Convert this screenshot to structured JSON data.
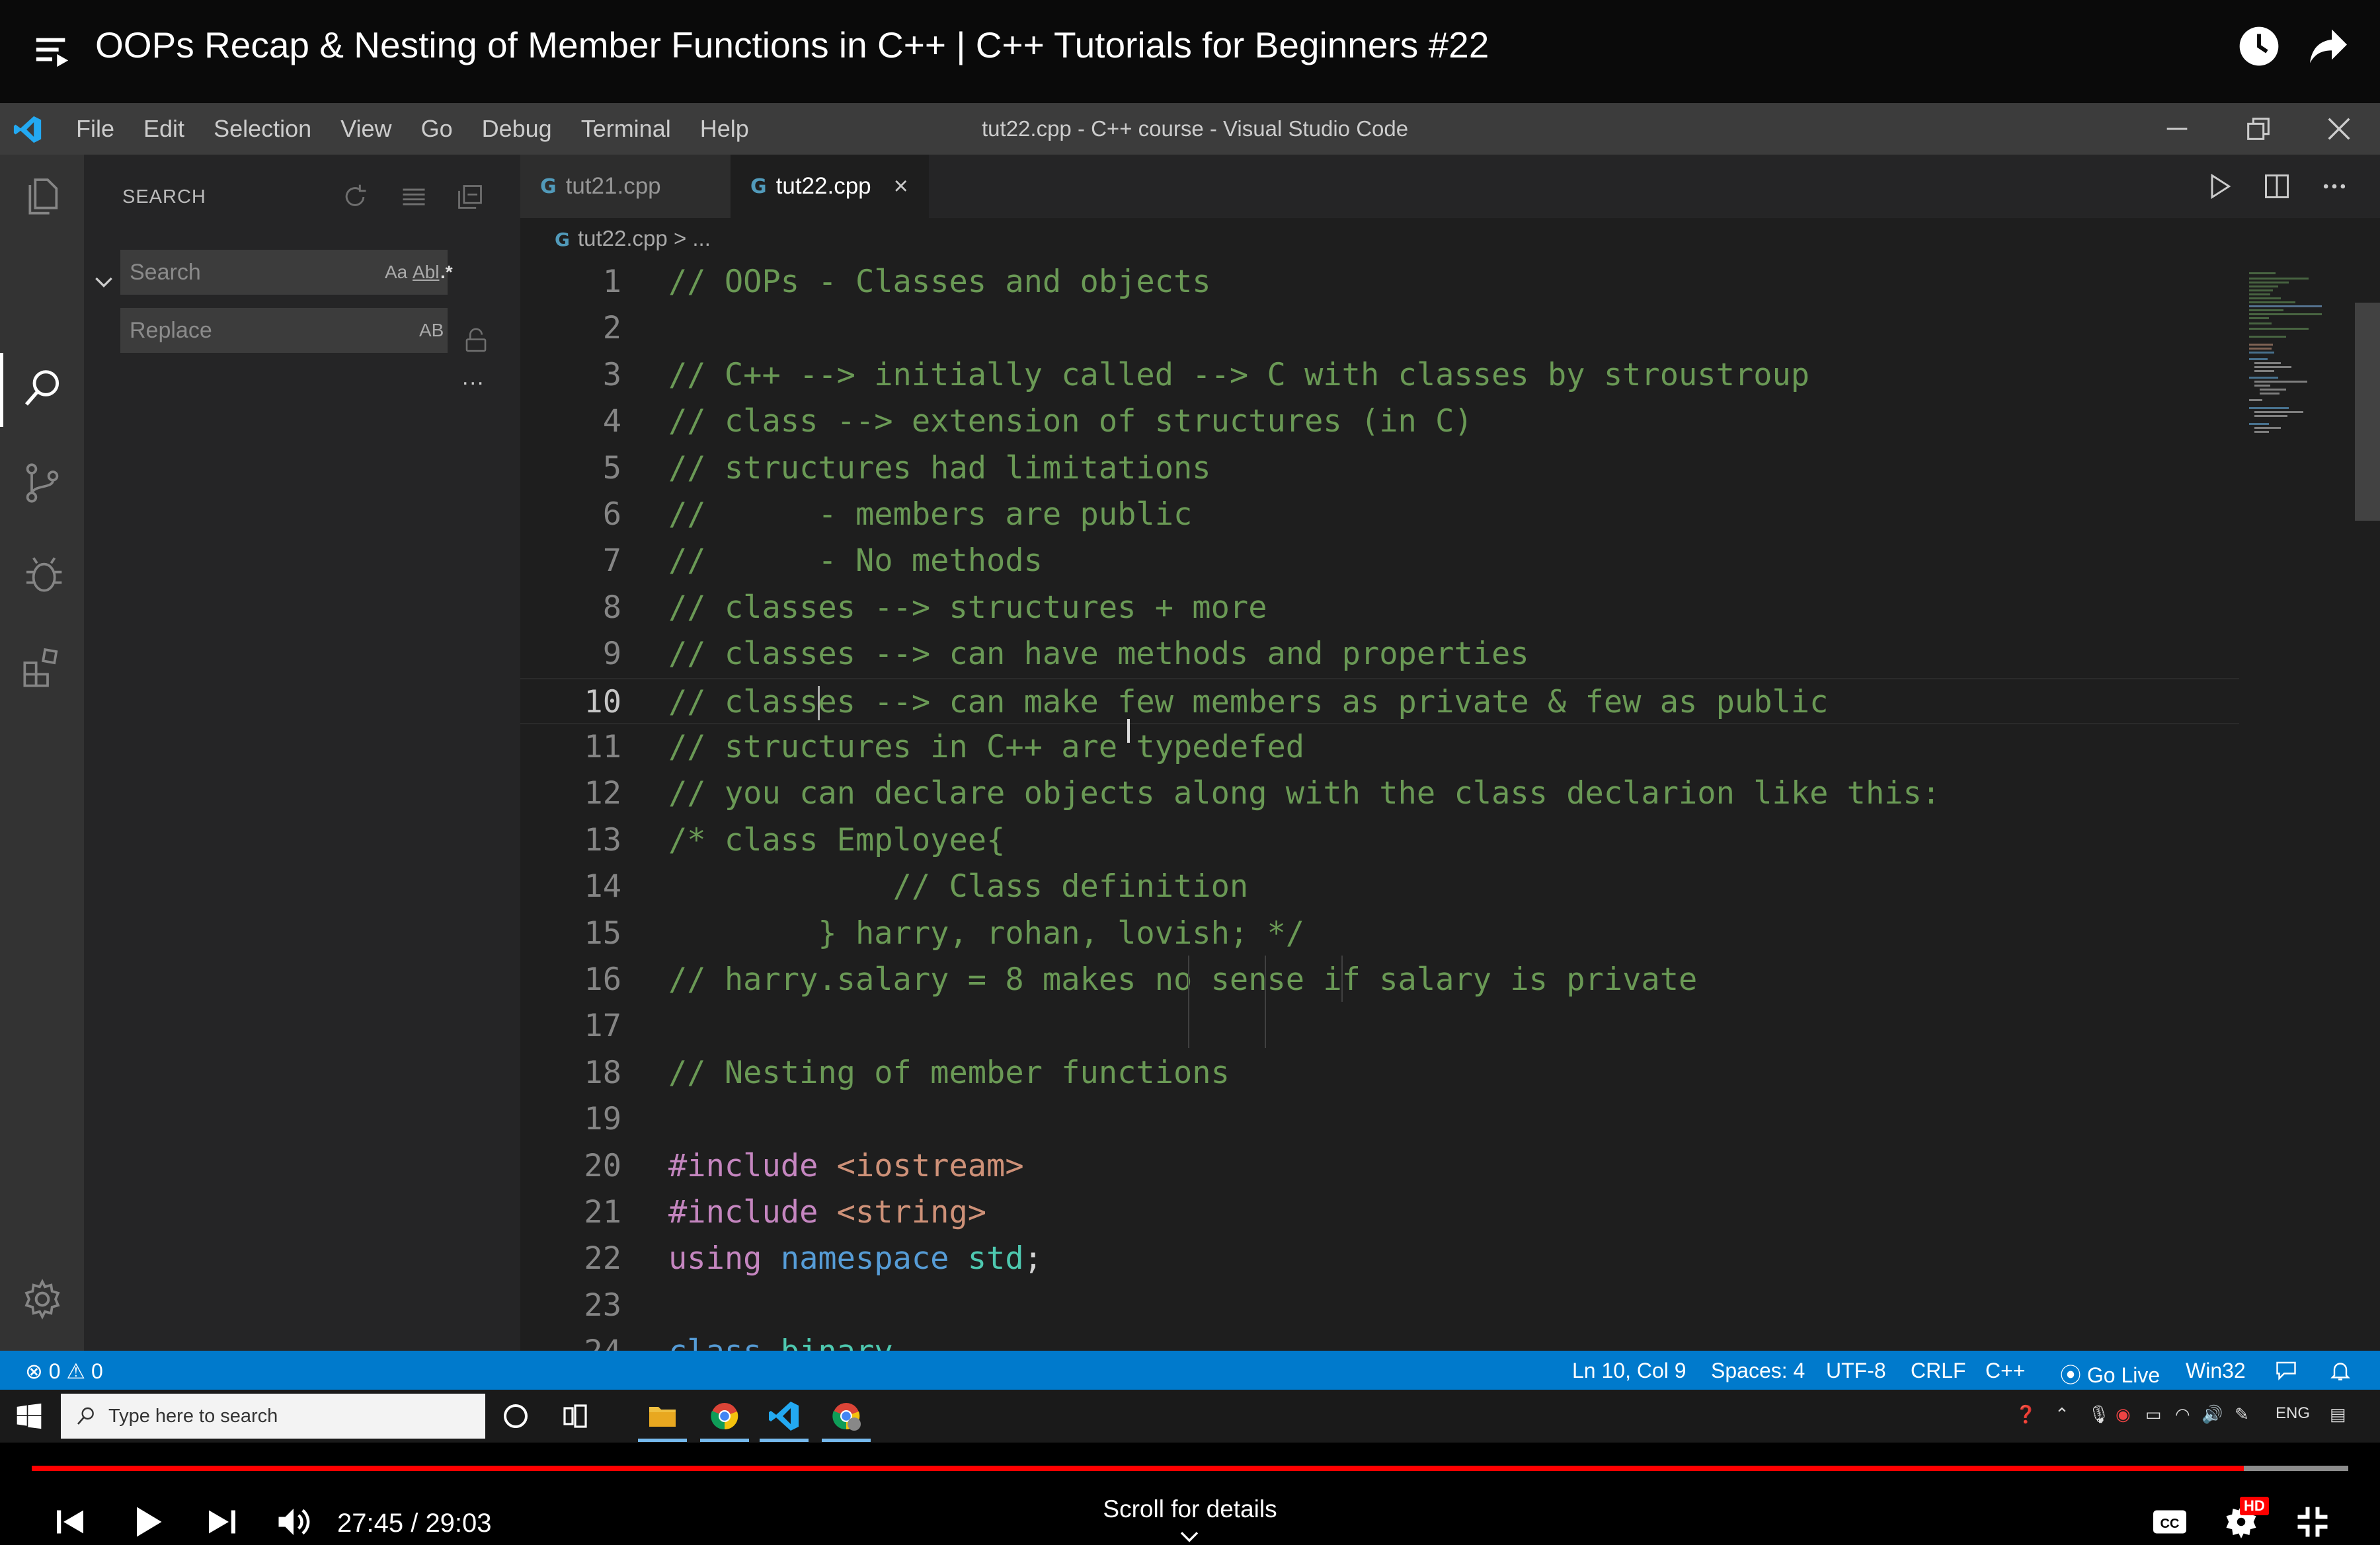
{
  "youtube": {
    "video_title": "OOPs Recap & Nesting of Member Functions in C++ | C++ Tutorials for Beginners #22",
    "icons": [
      "menu-icon",
      "watch-later-icon",
      "share-icon"
    ]
  },
  "vscode": {
    "menu": [
      "File",
      "Edit",
      "Selection",
      "View",
      "Go",
      "Debug",
      "Terminal",
      "Help"
    ],
    "window_title": "tut22.cpp - C++ course - Visual Studio Code",
    "sidebar": {
      "title": "SEARCH",
      "search_placeholder": "Search",
      "replace_placeholder": "Replace",
      "search_options": [
        "Aa",
        "Abl",
        ".*"
      ],
      "replace_option": "AB",
      "more": "..."
    },
    "tabs": [
      {
        "label": "tut21.cpp",
        "active": false
      },
      {
        "label": "tut22.cpp",
        "active": true
      }
    ],
    "breadcrumb": {
      "file": "tut22.cpp",
      "sep": ">",
      "rest": "..."
    },
    "code": [
      {
        "n": "1",
        "segs": [
          [
            "c",
            "// OOPs - Classes and objects"
          ]
        ]
      },
      {
        "n": "2",
        "segs": []
      },
      {
        "n": "3",
        "segs": [
          [
            "c",
            "// C++ --> initially called --> C with classes by stroustroup"
          ]
        ]
      },
      {
        "n": "4",
        "segs": [
          [
            "c",
            "// class --> extension of structures (in C)"
          ]
        ]
      },
      {
        "n": "5",
        "segs": [
          [
            "c",
            "// structures had limitations"
          ]
        ]
      },
      {
        "n": "6",
        "segs": [
          [
            "c",
            "//      - members are public"
          ]
        ]
      },
      {
        "n": "7",
        "segs": [
          [
            "c",
            "//      - No methods"
          ]
        ]
      },
      {
        "n": "8",
        "segs": [
          [
            "c",
            "// classes --> structures + more"
          ]
        ]
      },
      {
        "n": "9",
        "segs": [
          [
            "c",
            "// classes --> can have methods and properties"
          ]
        ]
      },
      {
        "n": "10",
        "segs": [
          [
            "c",
            "// classes --> can make few members as private & few as public"
          ]
        ]
      },
      {
        "n": "11",
        "segs": [
          [
            "c",
            "// structures in C++ are typedefed"
          ]
        ]
      },
      {
        "n": "12",
        "segs": [
          [
            "c",
            "// you can declare objects along with the class declarion like this:"
          ]
        ]
      },
      {
        "n": "13",
        "segs": [
          [
            "c",
            "/* class Employee{"
          ]
        ]
      },
      {
        "n": "14",
        "segs": [
          [
            "c",
            "            // Class definition"
          ]
        ]
      },
      {
        "n": "15",
        "segs": [
          [
            "c",
            "        } harry, rohan, lovish; */"
          ]
        ]
      },
      {
        "n": "16",
        "segs": [
          [
            "c",
            "// harry.salary = 8 makes no sense if salary is private"
          ]
        ]
      },
      {
        "n": "17",
        "segs": []
      },
      {
        "n": "18",
        "segs": [
          [
            "c",
            "// Nesting of member functions"
          ]
        ]
      },
      {
        "n": "19",
        "segs": []
      },
      {
        "n": "20",
        "segs": [
          [
            "k",
            "#include "
          ],
          [
            "s",
            "<iostream>"
          ]
        ]
      },
      {
        "n": "21",
        "segs": [
          [
            "k",
            "#include "
          ],
          [
            "s",
            "<string>"
          ]
        ]
      },
      {
        "n": "22",
        "segs": [
          [
            "k",
            "using "
          ],
          [
            "b",
            "namespace "
          ],
          [
            "t",
            "std"
          ],
          [
            "p",
            ";"
          ]
        ]
      },
      {
        "n": "23",
        "segs": []
      },
      {
        "n": "24",
        "segs": [
          [
            "b",
            "class "
          ],
          [
            "t",
            "binary"
          ]
        ]
      }
    ],
    "current_line": "10",
    "status": {
      "errors": "0",
      "warnings": "0",
      "position": "Ln 10, Col 9",
      "spaces": "Spaces: 4",
      "encoding": "UTF-8",
      "eol": "CRLF",
      "language": "C++",
      "golive": "Go Live",
      "platform": "Win32"
    }
  },
  "taskbar": {
    "search_placeholder": "Type here to search",
    "language": "ENG"
  },
  "player": {
    "time": "27:45 / 29:03",
    "progress_fraction": 0.955,
    "buffer_fraction": 1.0,
    "scroll_hint": "Scroll for details",
    "hd_badge": "HD"
  },
  "colors": {
    "accent": "#007acc",
    "comment": "#6a9955",
    "keyword": "#c586c0",
    "string": "#ce9178",
    "progress": "#ff0000"
  }
}
